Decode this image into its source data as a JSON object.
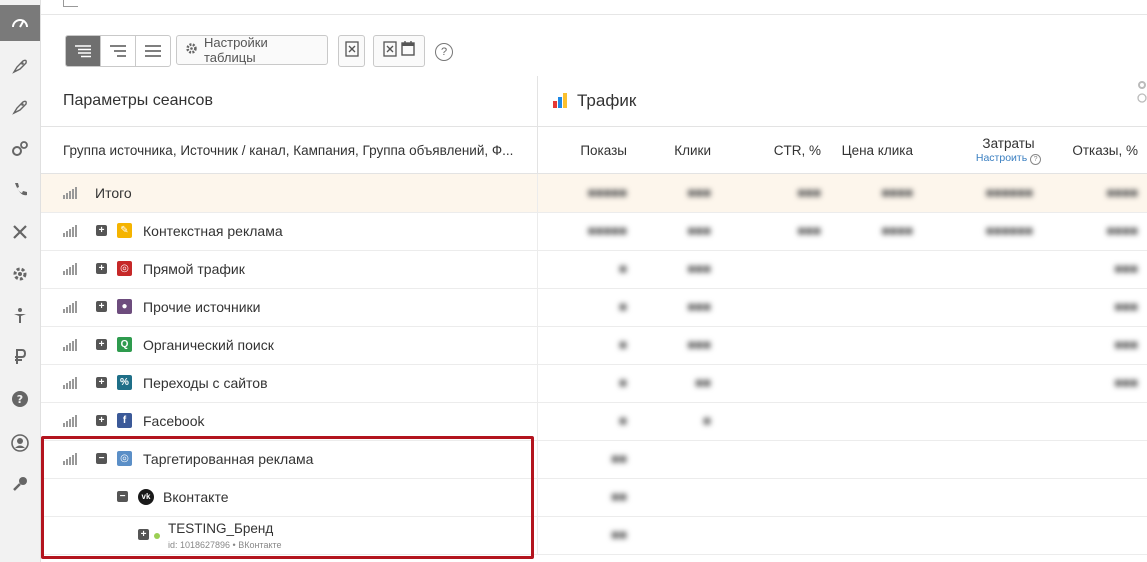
{
  "toolbar": {
    "table_settings_label": "Настройки таблицы",
    "help_label": "?"
  },
  "left_header": {
    "title": "Параметры сеансов"
  },
  "right_header": {
    "title": "Трафик"
  },
  "columns": {
    "dimensions": "Группа источника, Источник / канал, Кампания, Группа объявлений, Ф...",
    "impressions": "Показы",
    "clicks": "Клики",
    "ctr": "CTR, %",
    "cpc": "Цена клика",
    "cost": "Затраты",
    "cost_configure": "Настроить",
    "bounces": "Отказы, %"
  },
  "rows": [
    {
      "label": "Итого"
    },
    {
      "label": "Контекстная реклама"
    },
    {
      "label": "Прямой трафик"
    },
    {
      "label": "Прочие источники"
    },
    {
      "label": "Органический поиск"
    },
    {
      "label": "Переходы с сайтов"
    },
    {
      "label": "Facebook"
    },
    {
      "label": "Таргетированная реклама"
    },
    {
      "label": "Вконтакте"
    }
  ],
  "campaign": {
    "title": "TESTING_Бренд",
    "meta": "id: 1018627896  •  ВКонтакте"
  },
  "colors": {
    "highlight": "#b3141e",
    "accent_link": "#3a7fc1",
    "total_row_bg": "#fdf6ec"
  }
}
